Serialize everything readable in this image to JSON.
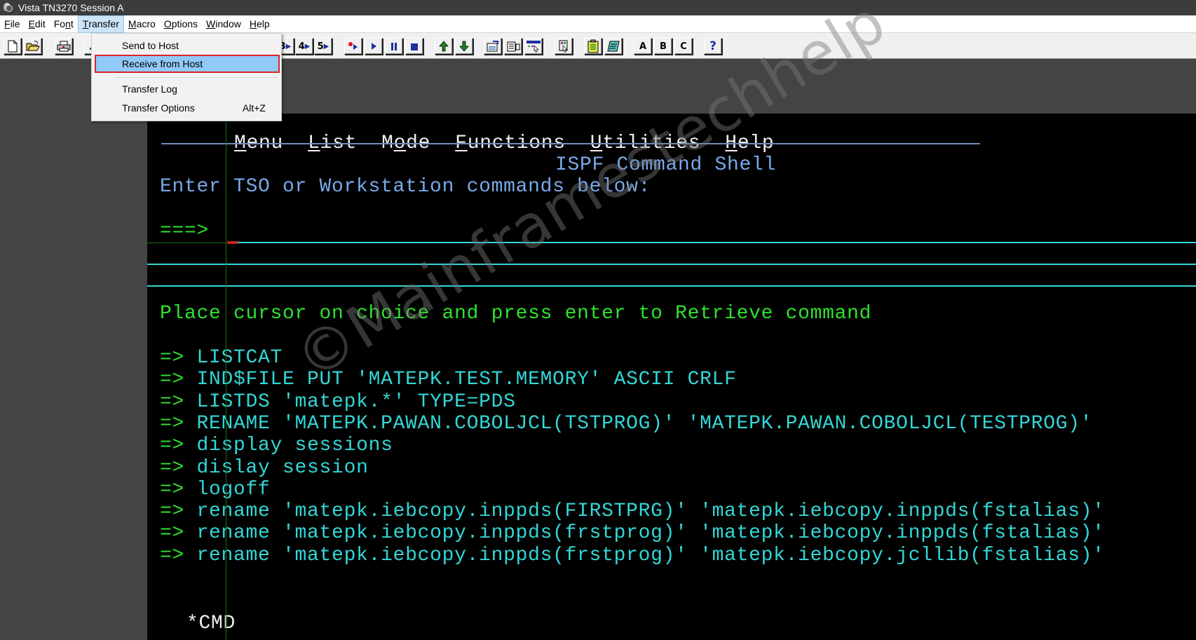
{
  "window": {
    "title": "Vista TN3270 Session A",
    "icon": "tn3270-app-icon"
  },
  "menubar": {
    "items": [
      {
        "label": "File",
        "mnemonic": "F",
        "rest": "ile"
      },
      {
        "label": "Edit",
        "mnemonic": "E",
        "rest": "dit"
      },
      {
        "label": "Font",
        "pre": "Fo",
        "mnemonic": "n",
        "rest": "t"
      },
      {
        "label": "Transfer",
        "mnemonic": "T",
        "rest": "ransfer",
        "active": true
      },
      {
        "label": "Macro",
        "mnemonic": "M",
        "rest": "acro"
      },
      {
        "label": "Options",
        "mnemonic": "O",
        "rest": "ptions"
      },
      {
        "label": "Window",
        "mnemonic": "W",
        "rest": "indow"
      },
      {
        "label": "Help",
        "mnemonic": "H",
        "rest": "elp"
      }
    ]
  },
  "transfer_menu": {
    "items": [
      {
        "label": "Send to Host",
        "shortcut": ""
      },
      {
        "label": "Receive from Host",
        "shortcut": "",
        "highlighted": true
      },
      {
        "label": "Transfer Log",
        "shortcut": ""
      },
      {
        "label": "Transfer Options",
        "shortcut": "Alt+Z"
      }
    ]
  },
  "toolbar": {
    "buttons": [
      {
        "name": "new-document",
        "icon": "new-document-icon"
      },
      {
        "name": "open-folder",
        "icon": "open-folder-icon"
      },
      {
        "name": "print",
        "icon": "printer-icon"
      },
      {
        "name": "keypad",
        "icon": "keypad-icon"
      },
      {
        "name": "macro-3",
        "label": "3"
      },
      {
        "name": "macro-4",
        "label": "4"
      },
      {
        "name": "macro-5",
        "label": "5"
      },
      {
        "name": "record",
        "icon": "record-icon"
      },
      {
        "name": "play",
        "icon": "play-icon"
      },
      {
        "name": "pause",
        "icon": "pause-icon"
      },
      {
        "name": "stop",
        "icon": "stop-icon"
      },
      {
        "name": "send",
        "icon": "arrow-up-icon"
      },
      {
        "name": "receive",
        "icon": "arrow-down-icon"
      },
      {
        "name": "properties",
        "icon": "properties-icon"
      },
      {
        "name": "transfer-list",
        "icon": "transfer-list-icon"
      },
      {
        "name": "select-screen",
        "icon": "select-screen-icon"
      },
      {
        "name": "hotspot",
        "icon": "hotspot-icon"
      },
      {
        "name": "clipboard",
        "icon": "clipboard-icon"
      },
      {
        "name": "notepad",
        "icon": "notepad-icon"
      },
      {
        "name": "session-a",
        "label": "A"
      },
      {
        "name": "session-b",
        "label": "B"
      },
      {
        "name": "session-c",
        "label": "C"
      },
      {
        "name": "help",
        "label": "?"
      }
    ]
  },
  "terminal": {
    "action_bar": [
      {
        "mnemonic": "M",
        "rest": "enu"
      },
      {
        "mnemonic": "L",
        "rest": "ist"
      },
      {
        "pre": "M",
        "mnemonic": "o",
        "rest": "de"
      },
      {
        "mnemonic": "F",
        "rest": "unctions"
      },
      {
        "mnemonic": "U",
        "rest": "tilities"
      },
      {
        "mnemonic": "H",
        "rest": "elp"
      }
    ],
    "panel_title": "ISPF Command Shell",
    "instruction": "Enter TSO or Workstation commands below:",
    "prompt": "===>",
    "command_input": "",
    "retrieve_hint": "Place cursor on choice and press enter to Retrieve command",
    "history_marker": "=>",
    "history": [
      "LISTCAT",
      "IND$FILE PUT 'MATEPK.TEST.MEMORY' ASCII CRLF",
      "LISTDS 'matepk.*' TYPE=PDS",
      "RENAME 'MATEPK.PAWAN.COBOLJCL(TSTPROG)' 'MATEPK.PAWAN.COBOLJCL(TESTPROG)'",
      "display sessions",
      "dislay session",
      "logoff",
      "rename 'matepk.iebcopy.inppds(FIRSTPRG)' 'matepk.iebcopy.inppds(fstalias)'",
      "rename 'matepk.iebcopy.inppds(frstprog)' 'matepk.iebcopy.inppds(fstalias)'",
      "rename 'matepk.iebcopy.inppds(frstprog)' 'matepk.iebcopy.jcllib(fstalias)'"
    ],
    "footer": "*CMD",
    "watermark": "©Mainframestechhelp"
  },
  "colors": {
    "terminal_bg": "#000000",
    "white_text": "#f0f0f0",
    "blue_text": "#79a9ea",
    "green_text": "#2ee22e",
    "cyan_text": "#34d6d6",
    "menu_highlight": "#91c9f7",
    "menu_highlight_border": "#d9262b",
    "cursor": "#c2271c"
  }
}
